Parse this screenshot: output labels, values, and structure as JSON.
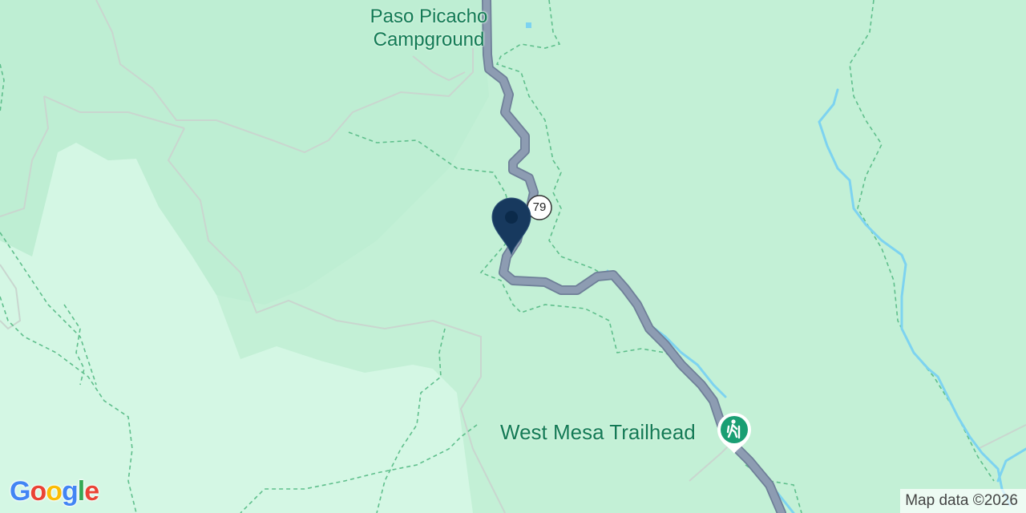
{
  "map": {
    "labels": {
      "campground_line1": "Paso Picacho",
      "campground_line2": "Campground",
      "trailhead": "West Mesa Trailhead"
    },
    "route_shield": "79",
    "pin": {
      "kind": "selected-location-pin",
      "color": "#17395e"
    },
    "trailhead_marker": {
      "icon": "hiker-icon",
      "color": "#1a9e73"
    },
    "google_logo": {
      "letters": [
        "G",
        "o",
        "o",
        "g",
        "l",
        "e"
      ],
      "colors": [
        "#4285f4",
        "#ea4335",
        "#fbbc05",
        "#4285f4",
        "#34a853",
        "#ea4335"
      ]
    },
    "attribution": "Map data ©2026",
    "colors": {
      "land": "#c3f0d6",
      "light_land": "#d4f7e4",
      "park": "#b7e9cc",
      "road": "#8d9cb2",
      "road_border": "#6e7f98",
      "trail": "#5fbf8c",
      "water": "#7dd3f0",
      "label": "#137a55"
    }
  }
}
